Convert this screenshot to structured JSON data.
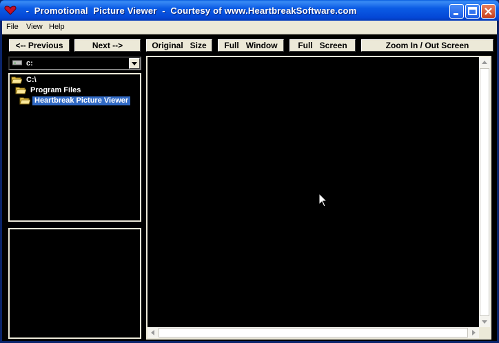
{
  "window": {
    "title": "  -  Promotional  Picture Viewer  -  Courtesy of www.HeartbreakSoftware.com",
    "controls": {
      "minimize": "_",
      "maximize": "□",
      "close": "✕"
    }
  },
  "menu": [
    {
      "label": "File"
    },
    {
      "label": "View"
    },
    {
      "label": "Help"
    }
  ],
  "toolbar": {
    "previous": "<-- Previous",
    "next": "Next -->",
    "original_size": "Original   Size",
    "full_window": "Full   Window",
    "full_screen": "Full   Screen",
    "zoom": "Zoom In / Out Screen"
  },
  "drive": {
    "value": "c:",
    "icon": "drive-icon"
  },
  "tree": [
    {
      "label": "C:\\",
      "icon": "folder-open-icon"
    },
    {
      "label": "Program Files",
      "icon": "folder-open-icon"
    },
    {
      "label": "Heartbreak Picture Viewer",
      "icon": "folder-open-icon",
      "selected": true
    }
  ],
  "colors": {
    "titlebar": "#0a5fe0",
    "selection": "#316ac5",
    "background": "#000000",
    "face": "#ece9d8"
  }
}
